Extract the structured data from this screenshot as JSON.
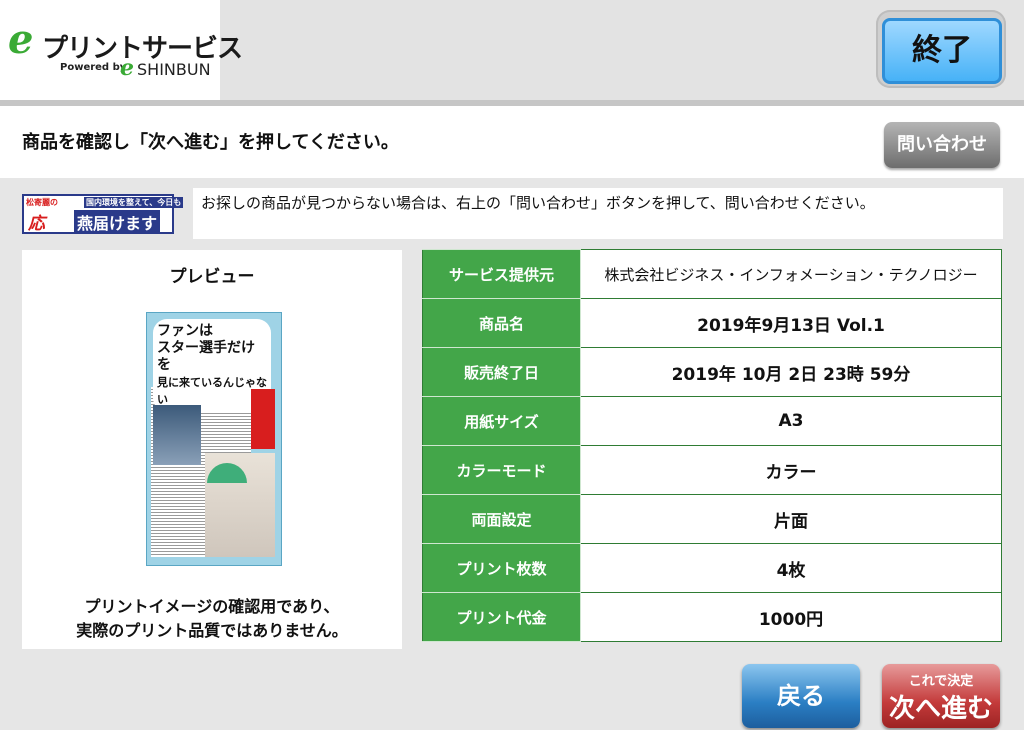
{
  "logo": {
    "mark": "e",
    "title": "プリントサービス",
    "powered_by": "Powered by",
    "mark2": "e",
    "brand": "SHINBUN"
  },
  "header": {
    "end_label": "終了"
  },
  "instruction": {
    "text": "商品を確認し「次へ進む」を押してください。",
    "contact_label": "問い合わせ"
  },
  "banner": {
    "top_left": "松寄麗の",
    "top_right": "国内環境を整えて、今日も",
    "main_left": "応",
    "main_right": "燕届けます"
  },
  "notice": {
    "text": "お探しの商品が見つからない場合は、右上の「問い合わせ」ボタンを押して、問い合わせください。"
  },
  "preview": {
    "title": "プレビュー",
    "headline_1": "ファンは",
    "headline_2": "スター選手だけを",
    "headline_3": "見に来ているんじゃない",
    "note_line1": "プリントイメージの確認用であり、",
    "note_line2": "実際のプリント品質ではありません。"
  },
  "details": [
    {
      "label": "サービス提供元",
      "value": "株式会社ビジネス・インフォメーション・テクノロジー"
    },
    {
      "label": "商品名",
      "value": "2019年9月13日 Vol.1"
    },
    {
      "label": "販売終了日",
      "value": "2019年 10月 2日 23時 59分"
    },
    {
      "label": "用紙サイズ",
      "value": "A3"
    },
    {
      "label": "カラーモード",
      "value": "カラー"
    },
    {
      "label": "両面設定",
      "value": "片面"
    },
    {
      "label": "プリント枚数",
      "value": "4枚"
    },
    {
      "label": "プリント代金",
      "value": "1000円"
    }
  ],
  "footer": {
    "back_label": "戻る",
    "next_sub": "これで決定",
    "next_label": "次へ進む"
  },
  "colors": {
    "green": "#43a649",
    "blue": "#47b2f7",
    "red": "#c43b3b"
  }
}
